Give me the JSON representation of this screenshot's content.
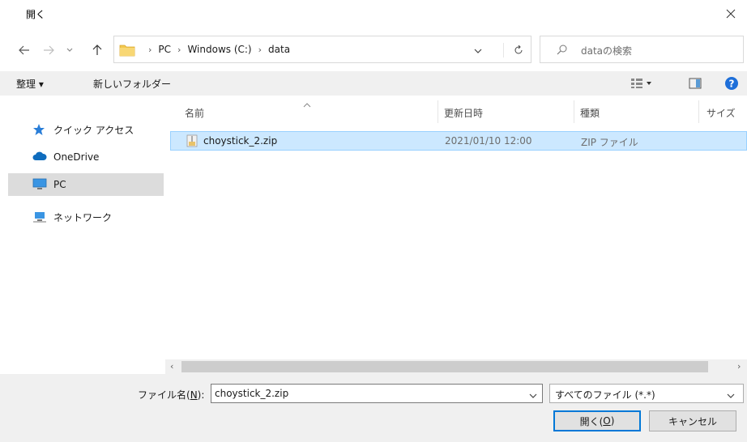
{
  "window": {
    "title": "開く"
  },
  "nav": {
    "crumbs": [
      "PC",
      "Windows (C:)",
      "data"
    ],
    "search_placeholder": "dataの検索"
  },
  "toolbar": {
    "organize": "整理 ▾",
    "new_folder": "新しいフォルダー"
  },
  "sidebar": {
    "items": [
      {
        "label": "クイック アクセス",
        "icon": "star-icon"
      },
      {
        "label": "OneDrive",
        "icon": "cloud-icon"
      },
      {
        "label": "PC",
        "icon": "monitor-icon",
        "selected": true
      },
      {
        "label": "ネットワーク",
        "icon": "network-icon"
      }
    ]
  },
  "columns": {
    "name": "名前",
    "modified": "更新日時",
    "type": "種類",
    "size": "サイズ"
  },
  "files": [
    {
      "name": "choystick_2.zip",
      "modified": "2021/01/10 12:00",
      "type": "ZIP ファイル",
      "size": ""
    }
  ],
  "footer": {
    "filename_label": "ファイル名(",
    "filename_key": "N",
    "filename_label_end": "):",
    "filename_value": "choystick_2.zip",
    "filetype": "すべてのファイル (*.*)",
    "open_label": "開く(",
    "open_key": "O",
    "open_label_end": ")",
    "cancel_label": "キャンセル"
  },
  "colors": {
    "accent": "#0078d7",
    "selection": "#cce8ff",
    "help": "#1e6fd9"
  }
}
